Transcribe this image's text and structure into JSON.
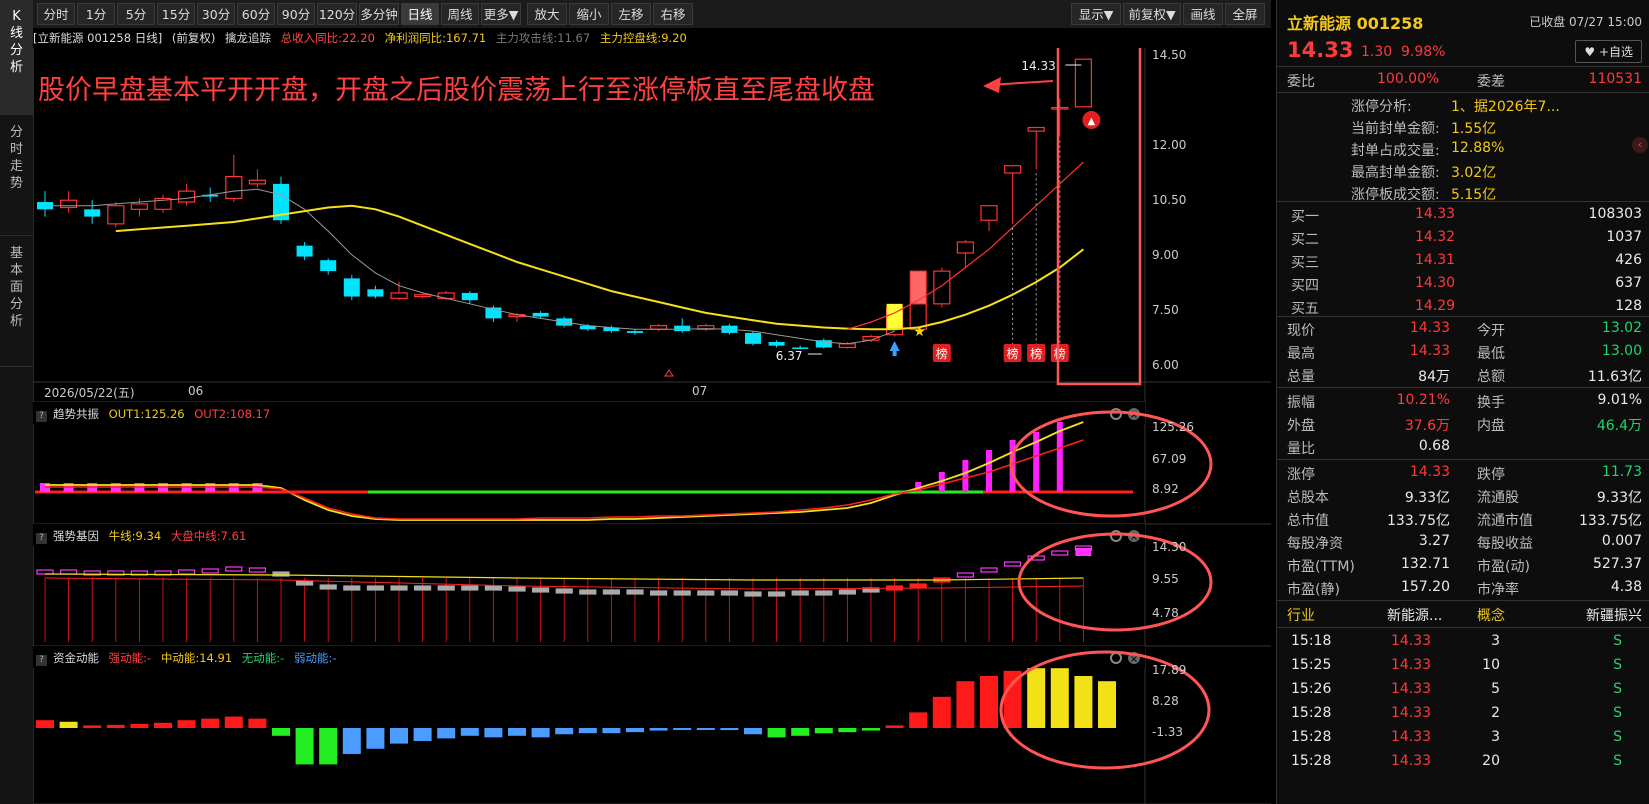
{
  "left_tabs": [
    {
      "label": "K线分析",
      "chars": [
        "K",
        "线",
        "分",
        "析"
      ]
    },
    {
      "label": "分时走势",
      "chars": [
        "分",
        "时",
        "走",
        "势"
      ]
    },
    {
      "label": "基本面分析",
      "chars": [
        "基",
        "本",
        "面",
        "分",
        "析"
      ]
    }
  ],
  "toolbar": {
    "periods": [
      "分时",
      "1分",
      "5分",
      "15分",
      "30分",
      "60分",
      "90分",
      "120分",
      "多分钟",
      "日线",
      "周线",
      "更多▼"
    ],
    "active_period": "日线",
    "actions": [
      "放大",
      "缩小",
      "左移",
      "右移"
    ],
    "right": [
      "显示▼",
      "前复权▼",
      "画线",
      "全屏"
    ]
  },
  "info_line": {
    "stock": "[立新能源 001258 日线]",
    "adjust": "(前复权)",
    "indicator": "擒龙追踪",
    "revenue": "总收入同比:22.20",
    "profit": "净利润同比:167.71",
    "attack": "主力攻击线:11.67",
    "control": "主力控盘线:9.20"
  },
  "annotation": {
    "text": "股价早盘基本平开开盘，开盘之后股价震荡上行至涨停板直至尾盘收盘",
    "color": "#ff4040"
  },
  "main_chart": {
    "y_ticks": [
      "14.50",
      "12.00",
      "10.50",
      "9.00",
      "7.50",
      "6.00"
    ],
    "date_label": "2026/05/22(五)",
    "month_labels": [
      "06",
      "07"
    ],
    "high_label": "14.33",
    "low_label": "6.37",
    "badge": "榜"
  },
  "chart_data": {
    "type": "candlestick",
    "price_range": [
      6.0,
      14.5
    ],
    "candles": [
      {
        "o": 10.4,
        "c": 10.2,
        "h": 10.7,
        "l": 10.0
      },
      {
        "o": 10.25,
        "c": 10.45,
        "h": 10.7,
        "l": 10.1
      },
      {
        "o": 10.2,
        "c": 10.0,
        "h": 10.45,
        "l": 9.8
      },
      {
        "o": 9.8,
        "c": 10.3,
        "h": 10.4,
        "l": 9.7
      },
      {
        "o": 10.2,
        "c": 10.35,
        "h": 10.5,
        "l": 10.0
      },
      {
        "o": 10.2,
        "c": 10.5,
        "h": 10.6,
        "l": 10.1
      },
      {
        "o": 10.4,
        "c": 10.7,
        "h": 10.9,
        "l": 10.3
      },
      {
        "o": 10.6,
        "c": 10.55,
        "h": 10.8,
        "l": 10.4
      },
      {
        "o": 10.5,
        "c": 11.1,
        "h": 11.7,
        "l": 10.4
      },
      {
        "o": 10.9,
        "c": 11.0,
        "h": 11.3,
        "l": 10.8
      },
      {
        "o": 10.9,
        "c": 9.9,
        "h": 11.1,
        "l": 9.8
      },
      {
        "o": 9.2,
        "c": 8.9,
        "h": 9.3,
        "l": 8.8
      },
      {
        "o": 8.8,
        "c": 8.5,
        "h": 8.85,
        "l": 8.4
      },
      {
        "o": 8.3,
        "c": 7.8,
        "h": 8.4,
        "l": 7.7
      },
      {
        "o": 8.0,
        "c": 7.8,
        "h": 8.1,
        "l": 7.75
      },
      {
        "o": 7.75,
        "c": 7.9,
        "h": 8.2,
        "l": 7.7
      },
      {
        "o": 7.8,
        "c": 7.85,
        "h": 7.9,
        "l": 7.75
      },
      {
        "o": 7.75,
        "c": 7.9,
        "h": 7.95,
        "l": 7.7
      },
      {
        "o": 7.9,
        "c": 7.7,
        "h": 7.95,
        "l": 7.6
      },
      {
        "o": 7.5,
        "c": 7.2,
        "h": 7.55,
        "l": 7.1
      },
      {
        "o": 7.25,
        "c": 7.3,
        "h": 7.35,
        "l": 7.1
      },
      {
        "o": 7.35,
        "c": 7.25,
        "h": 7.4,
        "l": 7.2
      },
      {
        "o": 7.2,
        "c": 7.0,
        "h": 7.25,
        "l": 6.95
      },
      {
        "o": 7.0,
        "c": 6.9,
        "h": 7.05,
        "l": 6.85
      },
      {
        "o": 6.95,
        "c": 6.85,
        "h": 7.0,
        "l": 6.8
      },
      {
        "o": 6.85,
        "c": 6.8,
        "h": 6.9,
        "l": 6.75
      },
      {
        "o": 6.9,
        "c": 7.0,
        "h": 7.05,
        "l": 6.85
      },
      {
        "o": 7.0,
        "c": 6.85,
        "h": 7.2,
        "l": 6.8
      },
      {
        "o": 6.9,
        "c": 7.0,
        "h": 7.05,
        "l": 6.85
      },
      {
        "o": 7.0,
        "c": 6.8,
        "h": 7.05,
        "l": 6.75
      },
      {
        "o": 6.8,
        "c": 6.5,
        "h": 6.85,
        "l": 6.45
      },
      {
        "o": 6.55,
        "c": 6.45,
        "h": 6.6,
        "l": 6.4
      },
      {
        "o": 6.4,
        "c": 6.38,
        "h": 6.45,
        "l": 6.35
      },
      {
        "o": 6.6,
        "c": 6.4,
        "h": 6.65,
        "l": 6.37
      },
      {
        "o": 6.4,
        "c": 6.5,
        "h": 6.55,
        "l": 6.37
      },
      {
        "o": 6.6,
        "c": 6.7,
        "h": 6.75,
        "l": 6.55
      },
      {
        "o": 6.75,
        "c": 7.5,
        "h": 7.55,
        "l": 6.7
      },
      {
        "o": 6.9,
        "c": 7.6,
        "h": 7.65,
        "l": 6.85
      },
      {
        "o": 7.6,
        "c": 8.5,
        "h": 8.6,
        "l": 7.5
      },
      {
        "o": 9.0,
        "c": 9.3,
        "h": 9.35,
        "l": 8.6
      },
      {
        "o": 9.9,
        "c": 10.3,
        "h": 10.3,
        "l": 9.6
      },
      {
        "o": 11.2,
        "c": 11.4,
        "h": 11.4,
        "l": 9.8
      },
      {
        "o": 12.35,
        "c": 12.45,
        "h": 12.45,
        "l": 11.3
      },
      {
        "o": 13.0,
        "c": 13.0,
        "h": 13.25,
        "l": 12.2
      },
      {
        "o": 13.02,
        "c": 14.33,
        "h": 14.33,
        "l": 13.0
      }
    ],
    "ma_yellow": [
      9.6,
      9.65,
      9.7,
      9.75,
      9.8,
      9.85,
      9.95,
      10.05,
      10.15,
      10.25,
      10.3,
      10.2,
      10.0,
      9.75,
      9.5,
      9.25,
      9.0,
      8.75,
      8.55,
      8.35,
      8.15,
      7.95,
      7.8,
      7.65,
      7.5,
      7.35,
      7.25,
      7.15,
      7.05,
      7.0,
      6.95,
      6.92,
      6.9,
      6.9,
      6.95,
      7.1,
      7.3,
      7.55,
      7.85,
      8.2,
      8.6,
      9.1
    ],
    "ma_gray": [
      10.3,
      10.3,
      10.3,
      10.35,
      10.4,
      10.45,
      10.5,
      10.6,
      10.7,
      10.75,
      10.6,
      10.2,
      9.6,
      8.95,
      8.45,
      8.1,
      7.9,
      7.75,
      7.6,
      7.45,
      7.3,
      7.2,
      7.1,
      7.0,
      6.95,
      6.9,
      6.9,
      6.9,
      6.92,
      6.9,
      6.85,
      6.75,
      6.65,
      6.55,
      6.5,
      6.6,
      6.85
    ],
    "ma_red": [
      6.9,
      7.1,
      7.35,
      7.7,
      8.1,
      8.6,
      9.1,
      9.7,
      10.3,
      10.9,
      11.5
    ],
    "panels": [
      {
        "title": "趋势共振",
        "labels": [
          "OUT1:125.26",
          "OUT2:108.17"
        ],
        "ticks": [
          "125.26",
          "67.09",
          "8.92"
        ]
      },
      {
        "title": "强势基因",
        "labels": [
          "牛线:9.34",
          "大盘中线:7.61"
        ],
        "ticks": [
          "14.30",
          "9.55",
          "4.78"
        ]
      },
      {
        "title": "资金动能",
        "labels": [
          "强动能:-",
          "中动能:14.91",
          "无动能:-",
          "弱动能:-"
        ],
        "ticks": [
          "17.89",
          "8.28",
          "-1.33"
        ],
        "values": [
          1.5,
          1.2,
          0.5,
          0.6,
          0.8,
          1.0,
          1.5,
          1.8,
          2.2,
          1.8,
          -1.5,
          -7,
          -7,
          -5,
          -4,
          -3,
          -2.5,
          -2,
          -1.5,
          -1.8,
          -1.5,
          -1.8,
          -1.2,
          -1.0,
          -1.0,
          -0.8,
          -0.5,
          -0.3,
          -0.2,
          -0.4,
          -1.2,
          -1.8,
          -1.5,
          -1.0,
          -0.8,
          -0.5,
          0.5,
          3,
          6,
          9,
          10,
          11,
          11.5,
          11.5,
          10,
          9
        ]
      }
    ]
  },
  "quote": {
    "name": "立新能源 001258",
    "status": "已收盘 07/27 15:00",
    "price": "14.33",
    "change": "1.30",
    "pct": "9.98%",
    "follow": "+自选",
    "weibi_label": "委比",
    "weibi": "100.00%",
    "weicha_label": "委差",
    "weicha": "110531",
    "limit_analysis": [
      {
        "k": "涨停分析:",
        "v": "1、据2026年7..."
      },
      {
        "k": "当前封单金额:",
        "v": "1.55亿"
      },
      {
        "k": "封单占成交量:",
        "v": "12.88%"
      },
      {
        "k": "最高封单金额:",
        "v": "3.02亿"
      },
      {
        "k": "涨停板成交额:",
        "v": "5.15亿"
      }
    ],
    "bids": [
      {
        "k": "买一",
        "p": "14.33",
        "v": "108303"
      },
      {
        "k": "买二",
        "p": "14.32",
        "v": "1037"
      },
      {
        "k": "买三",
        "p": "14.31",
        "v": "426"
      },
      {
        "k": "买四",
        "p": "14.30",
        "v": "637"
      },
      {
        "k": "买五",
        "p": "14.29",
        "v": "128"
      }
    ],
    "stats1": [
      {
        "k": "现价",
        "v": "14.33",
        "c": "red",
        "k2": "今开",
        "v2": "13.02",
        "c2": "green"
      },
      {
        "k": "最高",
        "v": "14.33",
        "c": "red",
        "k2": "最低",
        "v2": "13.00",
        "c2": "green"
      },
      {
        "k": "总量",
        "v": "84万",
        "c": "white",
        "k2": "总额",
        "v2": "11.63亿",
        "c2": "white"
      }
    ],
    "stats2": [
      {
        "k": "振幅",
        "v": "10.21%",
        "c": "red",
        "k2": "换手",
        "v2": "9.01%",
        "c2": "white"
      },
      {
        "k": "外盘",
        "v": "37.6万",
        "c": "red",
        "k2": "内盘",
        "v2": "46.4万",
        "c2": "green"
      },
      {
        "k": "量比",
        "v": "0.68",
        "c": "white",
        "k2": "",
        "v2": "",
        "c2": "white"
      }
    ],
    "stats3": [
      {
        "k": "涨停",
        "v": "14.33",
        "c": "red",
        "k2": "跌停",
        "v2": "11.73",
        "c2": "green"
      },
      {
        "k": "总股本",
        "v": "9.33亿",
        "c": "white",
        "k2": "流通股",
        "v2": "9.33亿",
        "c2": "white"
      },
      {
        "k": "总市值",
        "v": "133.75亿",
        "c": "white",
        "k2": "流通市值",
        "v2": "133.75亿",
        "c2": "white"
      },
      {
        "k": "每股净资",
        "v": "3.27",
        "c": "white",
        "k2": "每股收益",
        "v2": "0.007",
        "c2": "white"
      },
      {
        "k": "市盈(TTM)",
        "v": "132.71",
        "c": "white",
        "k2": "市盈(动)",
        "v2": "527.37",
        "c2": "white"
      },
      {
        "k": "市盈(静)",
        "v": "157.20",
        "c": "white",
        "k2": "市净率",
        "v2": "4.38",
        "c2": "white"
      }
    ],
    "industry_label": "行业",
    "industry": "新能源...",
    "concept_label": "概念",
    "concept": "新疆振兴",
    "ticks": [
      {
        "t": "15:18",
        "p": "14.33",
        "v": "3",
        "s": "S"
      },
      {
        "t": "15:25",
        "p": "14.33",
        "v": "10",
        "s": "S"
      },
      {
        "t": "15:26",
        "p": "14.33",
        "v": "5",
        "s": "S"
      },
      {
        "t": "15:28",
        "p": "14.33",
        "v": "2",
        "s": "S"
      },
      {
        "t": "15:28",
        "p": "14.33",
        "v": "3",
        "s": "S"
      },
      {
        "t": "15:28",
        "p": "14.33",
        "v": "20",
        "s": "S"
      }
    ]
  },
  "colors": {
    "up": "#ff3333",
    "down": "#00e5ff",
    "ma": "#f5e118",
    "gray": "#9a9a9a",
    "highlight": "#ff5555"
  }
}
